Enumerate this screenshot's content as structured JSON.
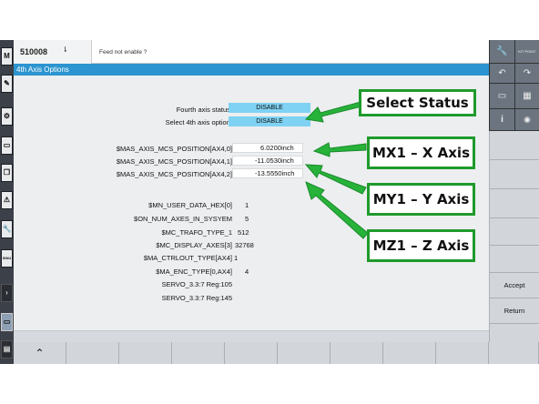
{
  "alarm": {
    "number": "510008",
    "symbol": "⇂",
    "message": "Feed not enable ?"
  },
  "title": "4th Axis Options",
  "left_toolbar": [
    {
      "icon": "m-logo-icon",
      "glyph": "M"
    },
    {
      "icon": "edit-icon",
      "glyph": "✎"
    },
    {
      "icon": "gear-icon",
      "glyph": "⚙"
    },
    {
      "icon": "rectangle-icon",
      "glyph": "▭"
    },
    {
      "icon": "copy-icon",
      "glyph": "❐"
    },
    {
      "icon": "warning-icon",
      "glyph": "⚠"
    },
    {
      "icon": "wrench-icon",
      "glyph": "🔧"
    },
    {
      "icon": "sinumerik-logo-icon",
      "glyph": "SINU"
    },
    {
      "icon": "arrow-right-icon",
      "glyph": "›"
    },
    {
      "icon": "window-icon",
      "glyph": "▭"
    },
    {
      "icon": "keyboard-icon",
      "glyph": "▤"
    }
  ],
  "fourth_axis": {
    "status_label": "Fourth axis status:",
    "status_value": "DISABLE",
    "option_label": "Select 4th axis option:",
    "option_value": "DISABLE"
  },
  "positions": [
    {
      "label": "$MAS_AXIS_MCS_POSITION[AX4,0]",
      "value": "6.0200inch"
    },
    {
      "label": "$MAS_AXIS_MCS_POSITION[AX4,1]",
      "value": "-11.0530inch"
    },
    {
      "label": "$MAS_AXIS_MCS_POSITION[AX4,2]",
      "value": "-13.5550inch"
    }
  ],
  "params": [
    {
      "label": "$MN_USER_DATA_HEX[0]",
      "value": "1"
    },
    {
      "label": "$ON_NUM_AXES_IN_SYSYEM",
      "value": "5"
    },
    {
      "label": "$MC_TRAFO_TYPE_1",
      "value": "512"
    },
    {
      "label": "$MC_DISPLAY_AXES[3]",
      "value": "32768"
    },
    {
      "label": "$MA_CTRLOUT_TYPE[AX4]",
      "value": "1"
    },
    {
      "label": "$MA_ENC_TYPE[0,AX4]",
      "value": "4"
    },
    {
      "label": "SERVO_3.3:7 Reg:105",
      "value": ""
    },
    {
      "label": "SERVO_3.3:7 Reg:145",
      "value": ""
    }
  ],
  "right_softkeys": {
    "wrench_icon": "🔧",
    "kit_point": "KIT POINT",
    "undo_icon": "↶",
    "redo_icon": "↷",
    "window_icon": "▭",
    "calc_icon": "▦",
    "info_icon": "i",
    "camera_icon": "◉",
    "accept": "Accept",
    "return": "Return"
  },
  "bottom_softkeys": {
    "up_icon": "⌃"
  },
  "callouts": {
    "select_status": "Select Status",
    "mx1": "MX1 – X Axis",
    "my1": "MY1 – Y Axis",
    "mz1": "MZ1 – Z Axis"
  },
  "colors": {
    "title_bar": "#2c94d0",
    "status_box": "#7fd2f3",
    "callout_green": "#1f9a2c"
  }
}
